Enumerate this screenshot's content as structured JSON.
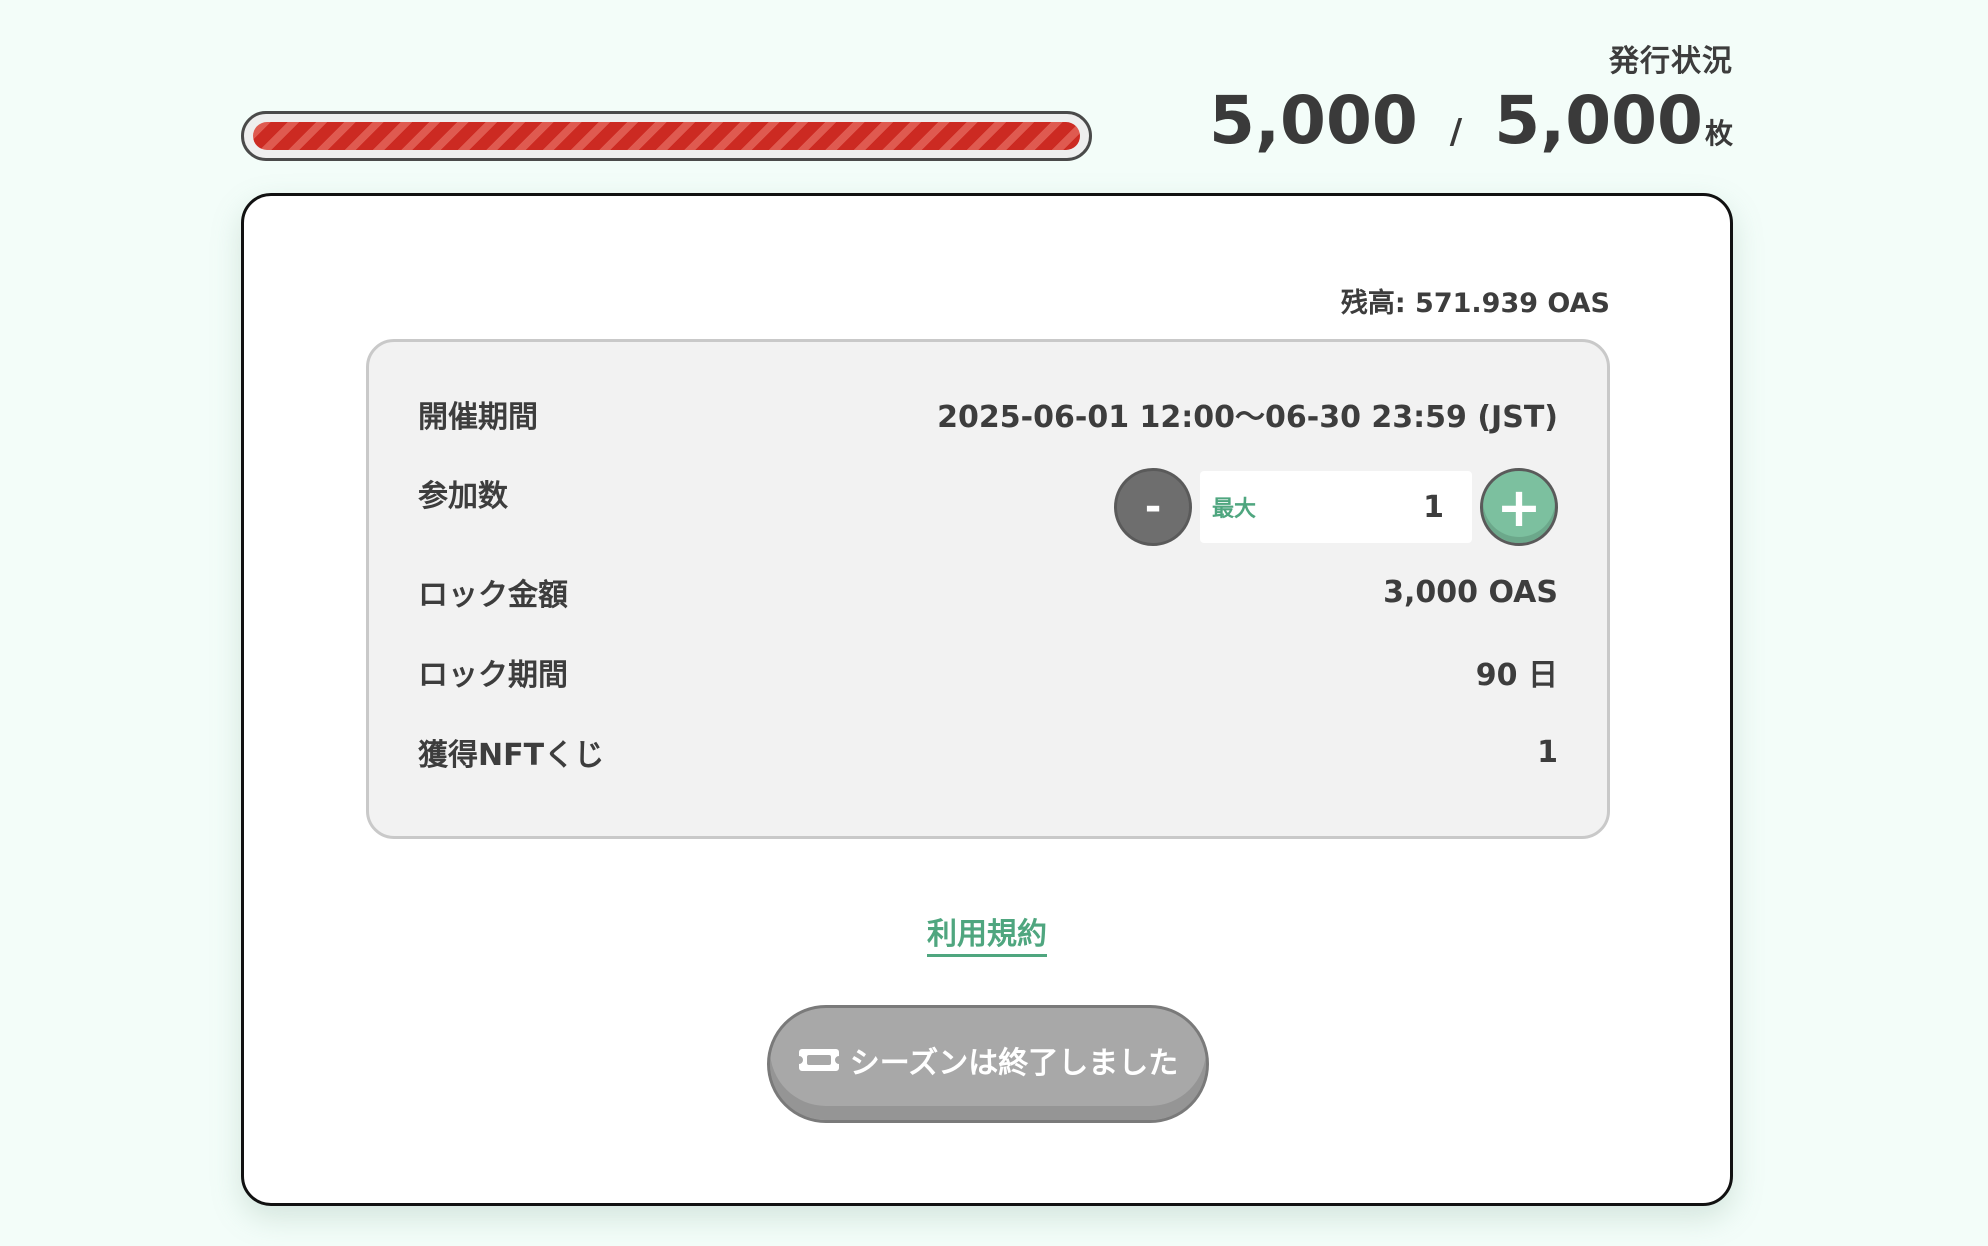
{
  "issue_status": {
    "label": "発行状況",
    "issued": "5,000",
    "separator": "/",
    "total": "5,000",
    "unit": "枚",
    "progress_fraction": 1.0
  },
  "balance": "残高: 571.939 OAS",
  "details": {
    "period_label": "開催期間",
    "period_value": "2025-06-01 12:00〜06-30 23:59 (JST)",
    "count_label": "参加数",
    "minus_label": "-",
    "max_label": "最大",
    "count_value": "1",
    "plus_label": "+",
    "lock_amount_label": "ロック金額",
    "lock_amount_value": "3,000 OAS",
    "lock_period_label": "ロック期間",
    "lock_period_value": "90 日",
    "nft_label": "獲得NFTくじ",
    "nft_value": "1"
  },
  "terms_link": "利用規約",
  "season_button": {
    "label": "シーズンは終了しました",
    "icon": "ticket-icon"
  },
  "colors": {
    "background": "#f3fdf9",
    "accent_green": "#4fa67f",
    "progress_red": "#cc2a22",
    "disabled_gray": "#a8a8a8"
  }
}
